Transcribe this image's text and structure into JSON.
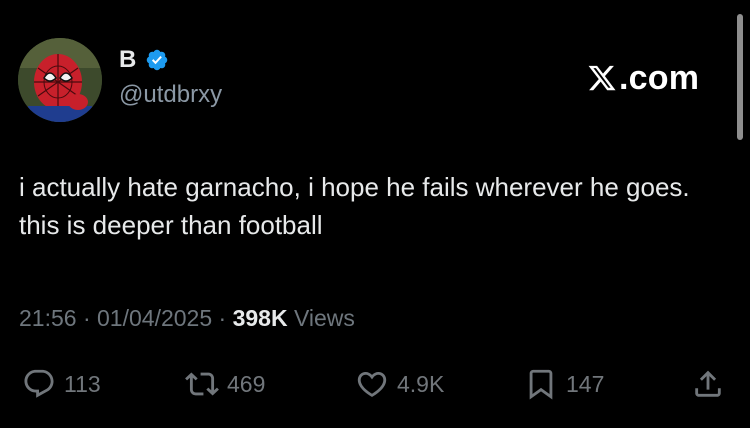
{
  "author": {
    "display_name": "B",
    "handle": "@utdbrxy",
    "verified": true,
    "avatar_icon": "spiderman-avatar-icon",
    "badge_color": "#1d9bf0"
  },
  "brand": {
    "suffix": ".com",
    "icon": "x-logo-icon"
  },
  "tweet": {
    "text": "i actually hate garnacho, i hope he fails wherever he goes. this is deeper than football"
  },
  "meta": {
    "time": "21:56",
    "sep1": " · ",
    "date": "01/04/2025",
    "sep2": " · ",
    "views_count": "398K",
    "views_label": " Views"
  },
  "actions": {
    "replies": {
      "icon": "reply-icon",
      "count": "113"
    },
    "reposts": {
      "icon": "repost-icon",
      "count": "469"
    },
    "likes": {
      "icon": "heart-icon",
      "count": "4.9K"
    },
    "bookmarks": {
      "icon": "bookmark-icon",
      "count": "147"
    },
    "share": {
      "icon": "share-icon"
    }
  },
  "colors": {
    "background": "#000000",
    "primary_text": "#e7e9ea",
    "secondary_text": "#71767b",
    "verified_blue": "#1d9bf0"
  }
}
